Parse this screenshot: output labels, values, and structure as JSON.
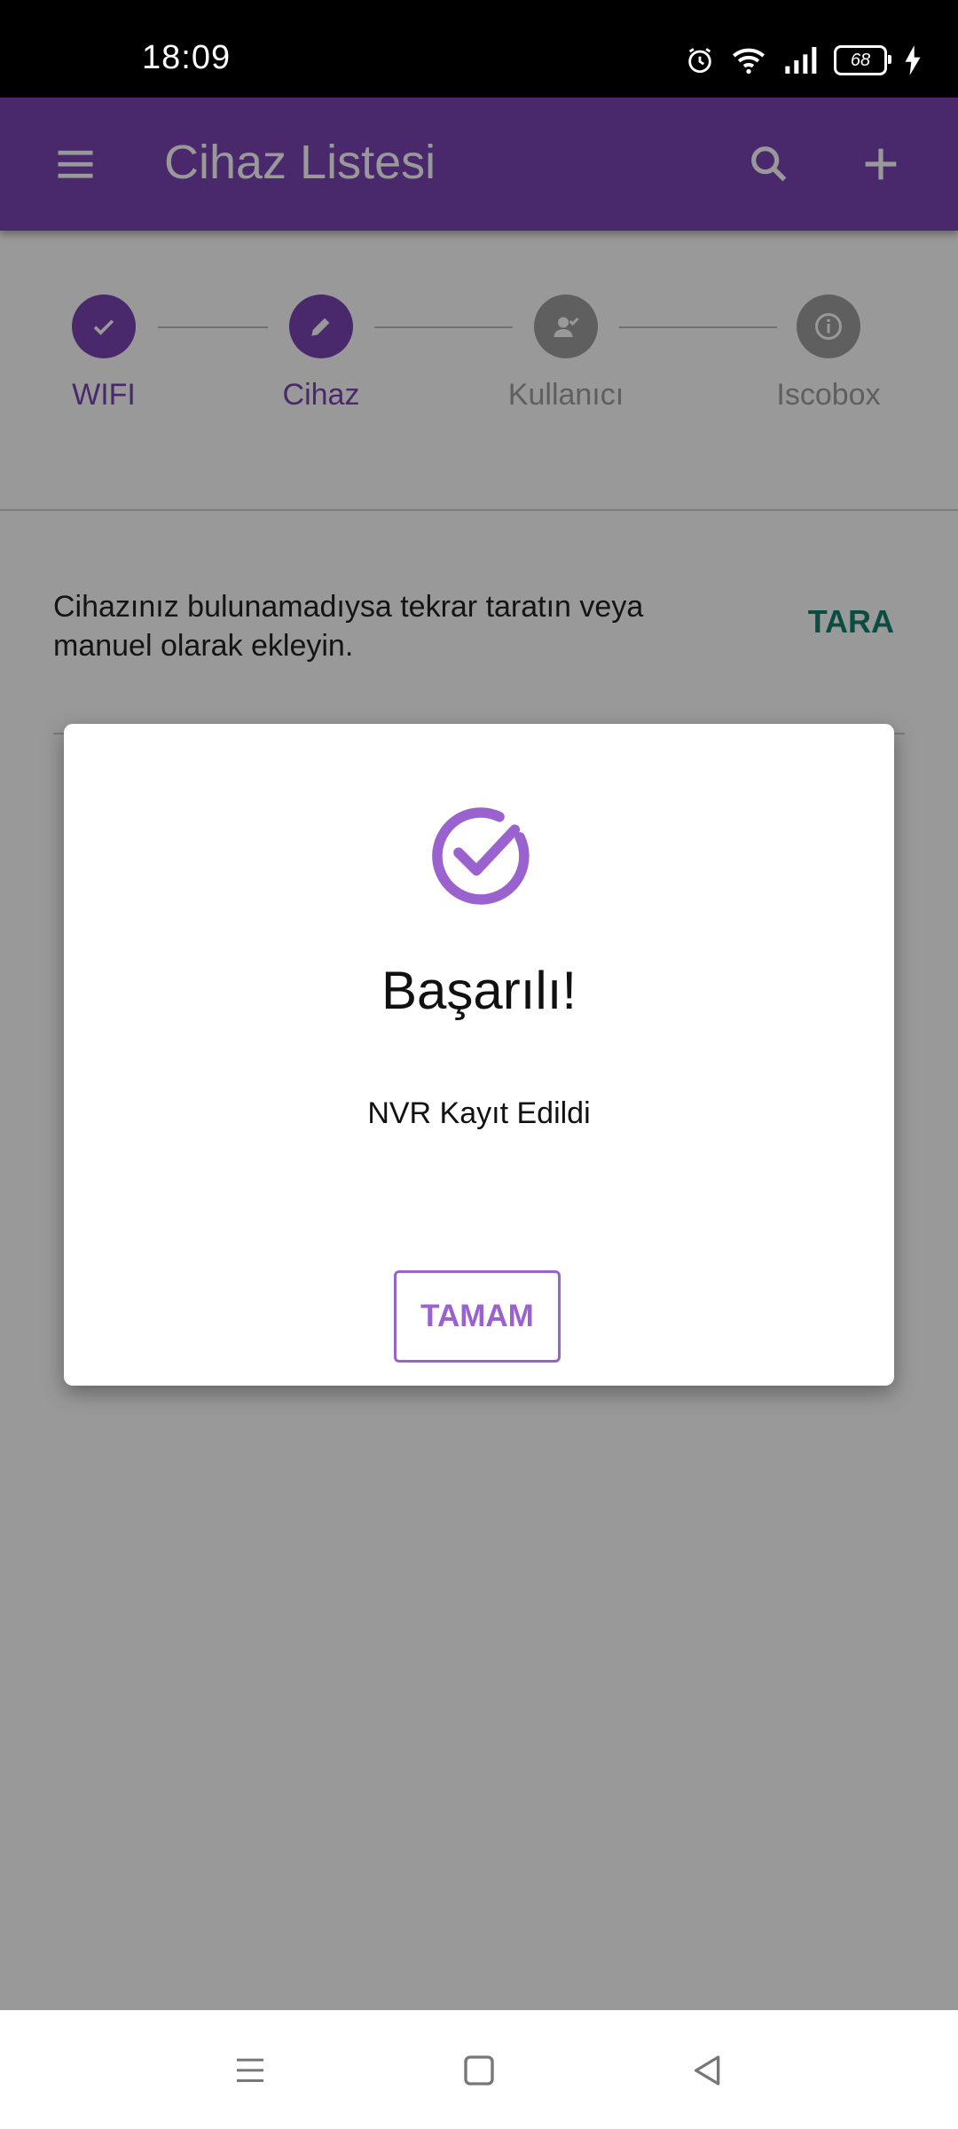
{
  "status_bar": {
    "time": "18:09",
    "battery": "68",
    "icons": [
      "alarm-icon",
      "wifi-icon",
      "signal-icon",
      "battery-icon",
      "charging-icon"
    ]
  },
  "app_bar": {
    "title": "Cihaz Listesi",
    "color": "#7b44b5",
    "icons": [
      "menu-icon",
      "search-icon",
      "add-icon"
    ]
  },
  "stepper": {
    "steps": [
      {
        "label": "WIFI",
        "state": "done",
        "icon": "check-icon"
      },
      {
        "label": "Cihaz",
        "state": "active",
        "icon": "edit-icon"
      },
      {
        "label": "Kullanıcı",
        "state": "inactive",
        "icon": "user-check-icon"
      },
      {
        "label": "Iscobox",
        "state": "inactive",
        "icon": "info-icon"
      }
    ]
  },
  "scan_section": {
    "message": "Cihazınız bulunamadıysa tekrar taratın veya manuel olarak ekleyin.",
    "scan_button": "TARA"
  },
  "dialog": {
    "icon": "success-check-icon",
    "title": "Başarılı!",
    "message": "NVR Kayıt Edildi",
    "ok_button": "TAMAM",
    "accent": "#9a62cf"
  },
  "nav_bar": {
    "icons": [
      "recent-apps-icon",
      "home-icon",
      "back-icon"
    ]
  }
}
